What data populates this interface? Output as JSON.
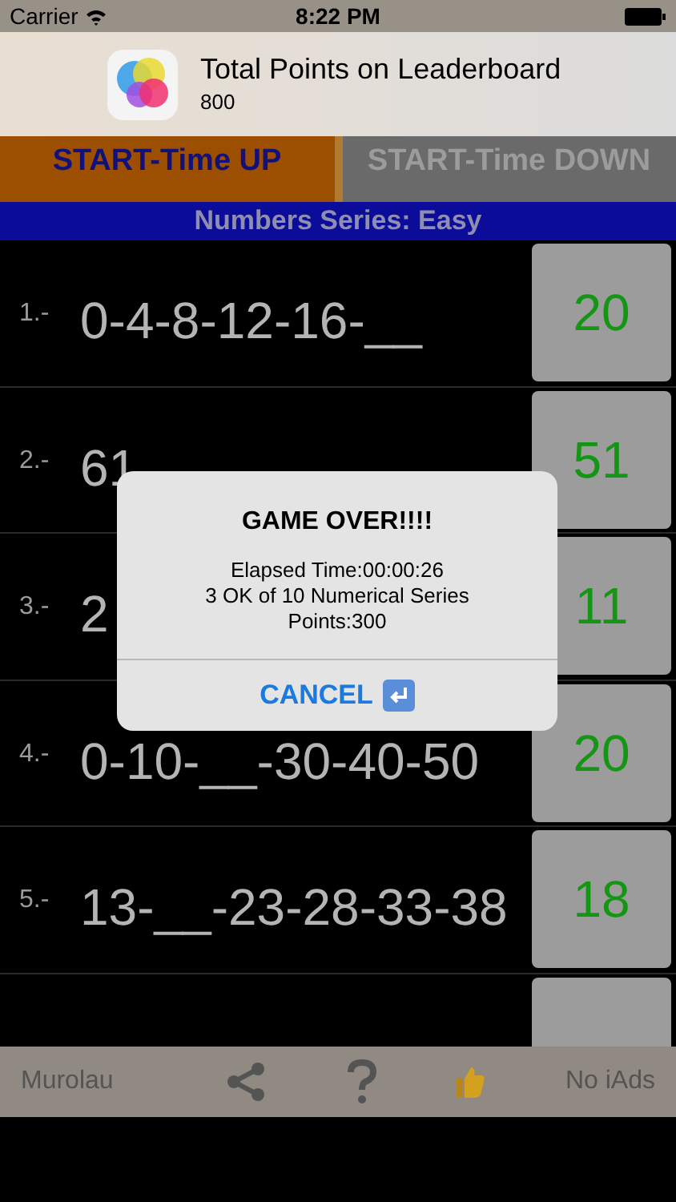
{
  "status_bar": {
    "carrier": "Carrier",
    "time": "8:22 PM"
  },
  "banner": {
    "title": "Total Points on Leaderboard",
    "value": "800"
  },
  "mode_tabs": [
    {
      "label": "START-Time UP",
      "selected": true
    },
    {
      "label": "START-Time DOWN",
      "selected": false
    }
  ],
  "series_header": "Numbers Series: Easy",
  "rows": [
    {
      "number": "1.-",
      "series": [
        "0-4-8-12-16-__"
      ],
      "answer": "20"
    },
    {
      "number": "2.-",
      "series": [
        "61"
      ],
      "answer": "51"
    },
    {
      "number": "3.-",
      "series": [
        "2"
      ],
      "answer": "11"
    },
    {
      "number": "4.-",
      "series": [
        "0-10-__-30-40-50"
      ],
      "answer": "20"
    },
    {
      "number": "5.-",
      "series": [
        "13-__-23-28-33-38"
      ],
      "answer": "18"
    }
  ],
  "dialog": {
    "title": "GAME OVER!!!!",
    "lines": [
      "Elapsed Time:00:00:26",
      "3 OK of 10 Numerical Series",
      "Points:300"
    ],
    "button": "CANCEL"
  },
  "toolbar": {
    "left": "Murolau",
    "right": "No iAds"
  }
}
